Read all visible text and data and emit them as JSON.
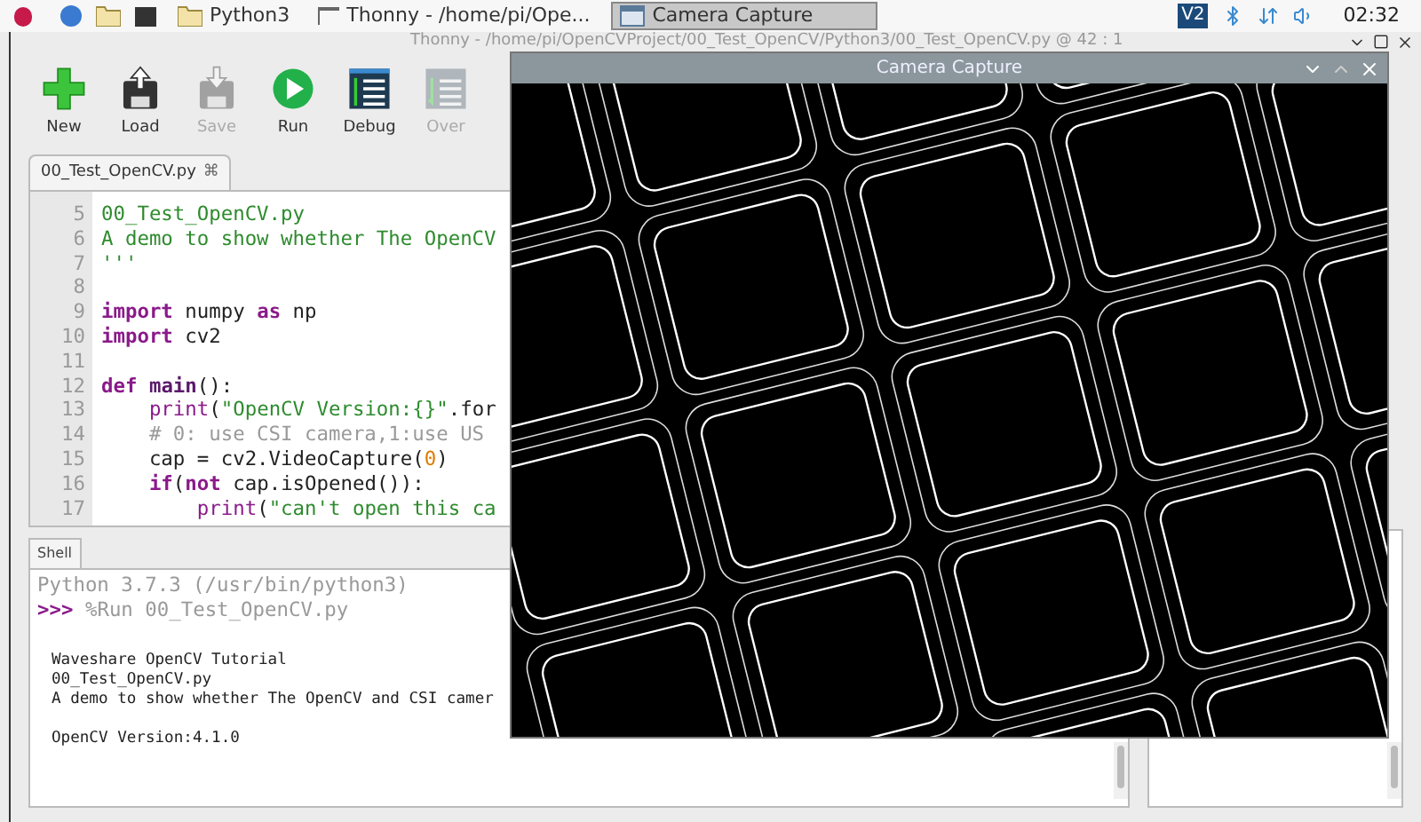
{
  "taskbar": {
    "tasks": [
      {
        "kind": "folder",
        "label": "Python3",
        "selected": false
      },
      {
        "kind": "thonny",
        "label": "Thonny - /home/pi/Ope...",
        "selected": false
      },
      {
        "kind": "window",
        "label": "Camera Capture",
        "selected": true
      }
    ],
    "vnc_label": "V2",
    "clock": "02:32"
  },
  "thonny": {
    "title": "Thonny - /home/pi/OpenCVProject/00_Test_OpenCV/Python3/00_Test_OpenCV.py @ 42 : 1",
    "toolbar": [
      {
        "kind": "new",
        "label": "New",
        "disabled": false
      },
      {
        "kind": "load",
        "label": "Load",
        "disabled": false
      },
      {
        "kind": "save",
        "label": "Save",
        "disabled": true
      },
      {
        "kind": "run",
        "label": "Run",
        "disabled": false
      },
      {
        "kind": "debug",
        "label": "Debug",
        "disabled": false
      },
      {
        "kind": "over",
        "label": "Over",
        "disabled": true
      }
    ],
    "editor": {
      "tab": "00_Test_OpenCV.py",
      "close": "⌘",
      "lines": [
        {
          "number": "5",
          "tokens": [
            {
              "kind": "string",
              "text": "00_Test_OpenCV.py"
            }
          ]
        },
        {
          "number": "6",
          "tokens": [
            {
              "kind": "string",
              "text": "A demo to show whether The OpenCV"
            }
          ]
        },
        {
          "number": "7",
          "tokens": [
            {
              "kind": "string",
              "text": "'''"
            }
          ]
        },
        {
          "number": "8"
        },
        {
          "number": "9",
          "tokens": [
            {
              "kind": "keyword",
              "text": "import"
            },
            {
              "kind": "plain",
              "text": " numpy "
            },
            {
              "kind": "keyword",
              "text": "as"
            },
            {
              "kind": "plain",
              "text": " np"
            }
          ]
        },
        {
          "number": "10",
          "tokens": [
            {
              "kind": "keyword",
              "text": "import"
            },
            {
              "kind": "plain",
              "text": " cv2"
            }
          ]
        },
        {
          "number": "11"
        },
        {
          "number": "12",
          "tokens": [
            {
              "kind": "keyword",
              "text": "def"
            },
            {
              "kind": "name",
              "text": " main"
            },
            {
              "kind": "plain",
              "text": "():"
            }
          ]
        },
        {
          "number": "13",
          "tokens": [
            {
              "kind": "builtin",
              "text": "    print"
            },
            {
              "kind": "plain",
              "text": "("
            },
            {
              "kind": "string",
              "text": "\"OpenCV Version:{}\""
            },
            {
              "kind": "plain",
              "text": ".for"
            }
          ]
        },
        {
          "number": "14",
          "tokens": [
            {
              "kind": "comment",
              "text": "    # 0: use CSI camera,1:use US"
            }
          ]
        },
        {
          "number": "15",
          "tokens": [
            {
              "kind": "plain",
              "text": "    cap = cv2.VideoCapture("
            },
            {
              "kind": "number",
              "text": "0"
            },
            {
              "kind": "plain",
              "text": ")"
            }
          ]
        },
        {
          "number": "16",
          "tokens": [
            {
              "kind": "keyword",
              "text": "    if"
            },
            {
              "kind": "plain",
              "text": "("
            },
            {
              "kind": "keyword",
              "text": "not"
            },
            {
              "kind": "plain",
              "text": " cap.isOpened()):"
            }
          ]
        },
        {
          "number": "17",
          "tokens": [
            {
              "kind": "builtin",
              "text": "        print"
            },
            {
              "kind": "plain",
              "text": "("
            },
            {
              "kind": "string",
              "text": "\"can't open this ca"
            }
          ]
        }
      ]
    },
    "shell": {
      "tab": "Shell",
      "banner": "Python 3.7.3 (/usr/bin/python3)",
      "prompt": ">>>",
      "command": "%Run 00_Test_OpenCV.py",
      "output_blocks": [
        [
          "Waveshare OpenCV Tutorial",
          "00_Test_OpenCV.py",
          "A demo to show whether The OpenCV and CSI camer"
        ],
        [
          "OpenCV Version:4.1.0"
        ]
      ]
    }
  },
  "camera": {
    "title": "Camera Capture"
  }
}
